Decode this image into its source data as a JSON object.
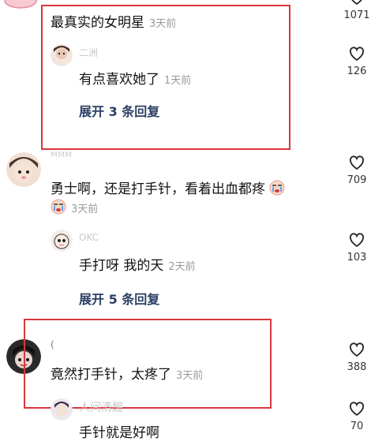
{
  "comments": [
    {
      "text": "最真实的女明星",
      "time": "3天前",
      "likes": "1071",
      "reply": {
        "user": "二洲",
        "text": "有点喜欢她了",
        "time": "1天前",
        "likes": "126"
      },
      "expand": "展开 3 条回复"
    },
    {
      "user": "ᴍᴍᴍ",
      "text": "勇士啊，还是打手针，看着出血都疼",
      "time": "3天前",
      "likes": "709",
      "reply": {
        "user": "OKC",
        "text": "手打呀 我的天",
        "time": "2天前",
        "likes": "103"
      },
      "expand": "展开 5 条回复"
    },
    {
      "user": "(",
      "text": "竟然打手针，太疼了",
      "time": "3天前",
      "likes": "388",
      "reply": {
        "user": "人间清醒",
        "text": "手针就是好啊",
        "likes": "70"
      }
    }
  ],
  "icons": {
    "like": "heart-outline-icon",
    "crying": "crying-emoji-icon"
  },
  "colors": {
    "highlight_box": "#d9363e",
    "expand_text": "#2b3f63",
    "time_text": "#9a9a9a"
  }
}
